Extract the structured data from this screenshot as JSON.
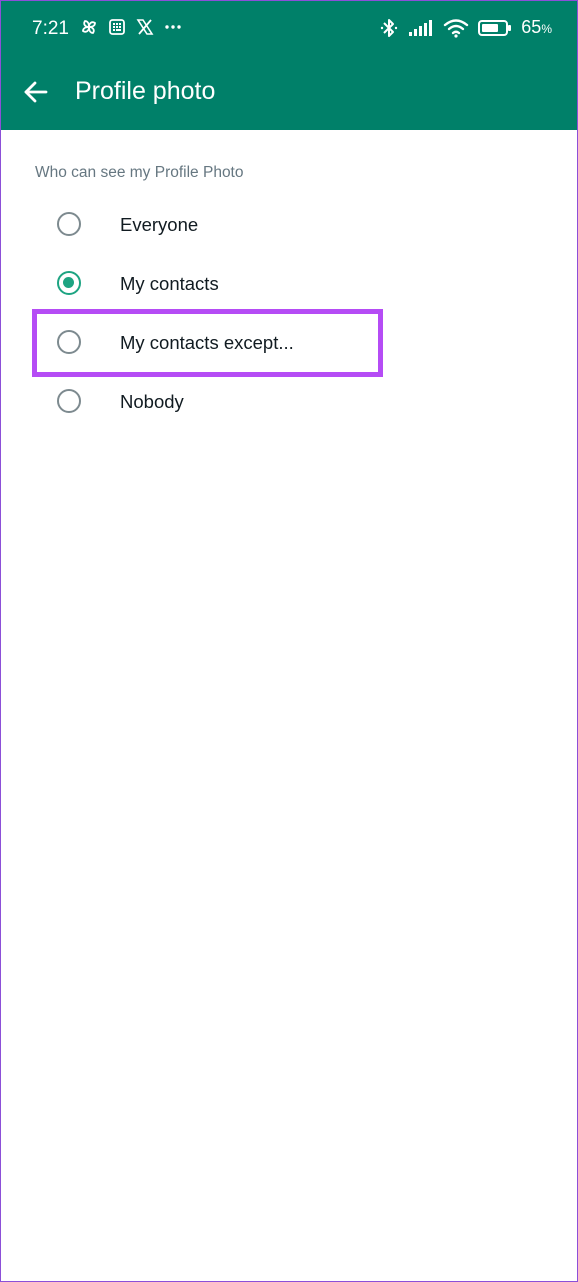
{
  "status_bar": {
    "time": "7:21",
    "left_icons": [
      "pinwheel-icon",
      "calculator-icon",
      "x-icon",
      "more-dots-icon"
    ],
    "right_icons": [
      "bluetooth-icon",
      "signal-icon",
      "wifi-icon",
      "battery-icon"
    ],
    "battery_value": "65",
    "battery_unit": "%"
  },
  "app_bar": {
    "title": "Profile photo",
    "back_icon": "arrow-left-icon"
  },
  "section": {
    "label": "Who can see my Profile Photo"
  },
  "options": [
    {
      "label": "Everyone",
      "checked": false
    },
    {
      "label": "My contacts",
      "checked": true
    },
    {
      "label": "My contacts except...",
      "checked": false
    },
    {
      "label": "Nobody",
      "checked": false
    }
  ],
  "colors": {
    "header": "#008069",
    "accent": "#1da482",
    "highlight": "#b54cf5"
  }
}
